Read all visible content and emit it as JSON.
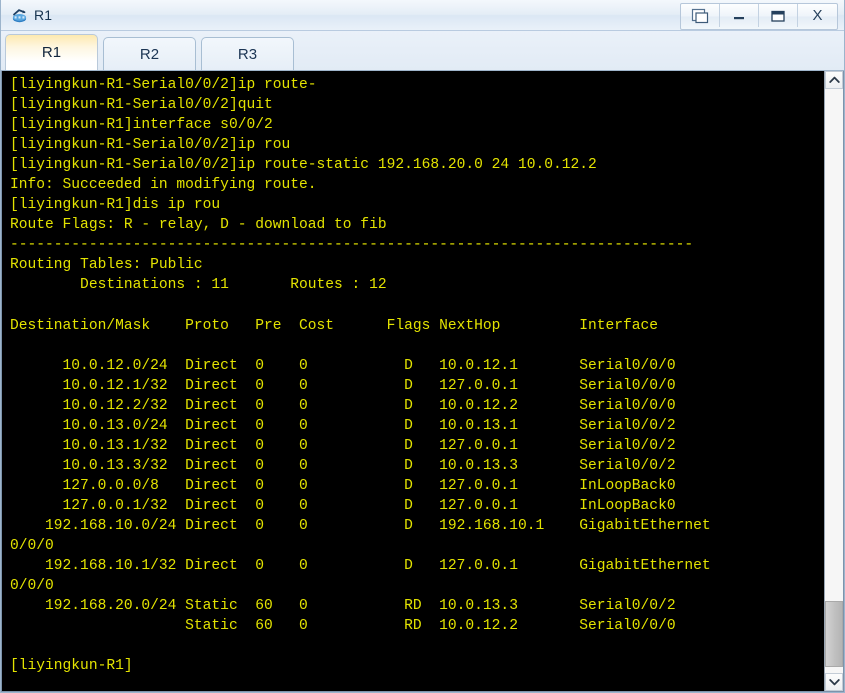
{
  "window": {
    "title": "R1",
    "icon": "router-icon",
    "controls": [
      {
        "name": "restore-cascade-button",
        "glyph": "cascade"
      },
      {
        "name": "minimize-button",
        "glyph": "minimize"
      },
      {
        "name": "maximize-button",
        "glyph": "maximize"
      },
      {
        "name": "close-button",
        "glyph": "X"
      }
    ]
  },
  "tabs": [
    {
      "label": "R1",
      "active": true
    },
    {
      "label": "R2",
      "active": false
    },
    {
      "label": "R3",
      "active": false
    }
  ],
  "terminal": {
    "foreground": "#e3e300",
    "background": "#000000",
    "lines": [
      "[liyingkun-R1-Serial0/0/2]ip route-",
      "[liyingkun-R1-Serial0/0/2]quit",
      "[liyingkun-R1]interface s0/0/2",
      "[liyingkun-R1-Serial0/0/2]ip rou",
      "[liyingkun-R1-Serial0/0/2]ip route-static 192.168.20.0 24 10.0.12.2",
      "Info: Succeeded in modifying route.",
      "[liyingkun-R1]dis ip rou",
      "Route Flags: R - relay, D - download to fib",
      "------------------------------------------------------------------------------",
      "Routing Tables: Public",
      "        Destinations : 11       Routes : 12",
      "",
      "Destination/Mask    Proto   Pre  Cost      Flags NextHop         Interface",
      "",
      "      10.0.12.0/24  Direct  0    0           D   10.0.12.1       Serial0/0/0",
      "      10.0.12.1/32  Direct  0    0           D   127.0.0.1       Serial0/0/0",
      "      10.0.12.2/32  Direct  0    0           D   10.0.12.2       Serial0/0/0",
      "      10.0.13.0/24  Direct  0    0           D   10.0.13.1       Serial0/0/2",
      "      10.0.13.1/32  Direct  0    0           D   127.0.0.1       Serial0/0/2",
      "      10.0.13.3/32  Direct  0    0           D   10.0.13.3       Serial0/0/2",
      "      127.0.0.0/8   Direct  0    0           D   127.0.0.1       InLoopBack0",
      "      127.0.0.1/32  Direct  0    0           D   127.0.0.1       InLoopBack0",
      "    192.168.10.0/24 Direct  0    0           D   192.168.10.1    GigabitEthernet",
      "0/0/0",
      "    192.168.10.1/32 Direct  0    0           D   127.0.0.1       GigabitEthernet",
      "0/0/0",
      "    192.168.20.0/24 Static  60   0           RD  10.0.13.3       Serial0/0/2",
      "                    Static  60   0           RD  10.0.12.2       Serial0/0/0",
      "",
      "[liyingkun-R1]"
    ]
  },
  "scrollbar": {
    "up_arrow": "chevron-up-icon",
    "down_arrow": "chevron-down-icon"
  }
}
